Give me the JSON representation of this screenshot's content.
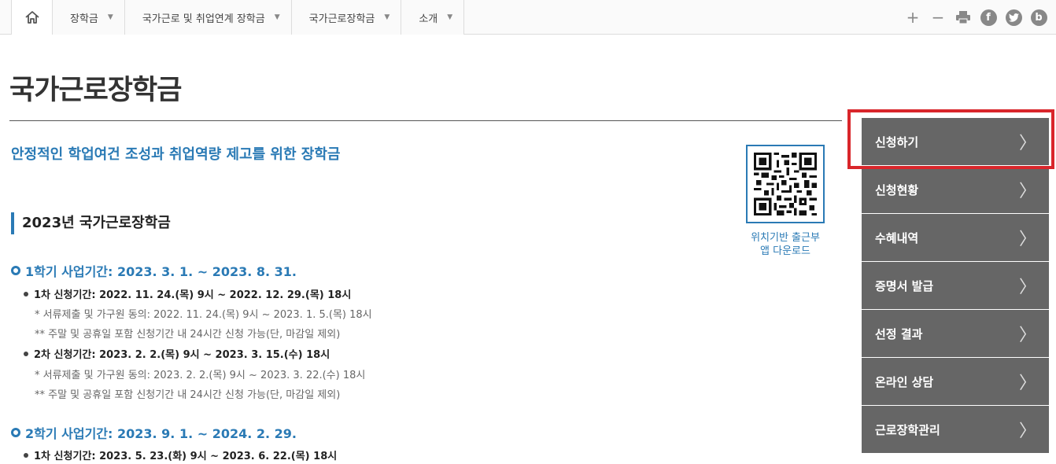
{
  "nav": {
    "items": [
      {
        "label": "장학금"
      },
      {
        "label": "국가근로 및 취업연계 장학금"
      },
      {
        "label": "국가근로장학금"
      },
      {
        "label": "소개"
      }
    ],
    "tools": {
      "plus": "+",
      "minus": "−",
      "facebook": "f",
      "blog": "b"
    }
  },
  "page": {
    "title": "국가근로장학금",
    "subtitle": "안정적인 학업여건 조성과 취업역량 제고를 위한 장학금",
    "qr_caption_line1": "위치기반 출근부",
    "qr_caption_line2": "앱 다운로드",
    "section_title": "2023년 국가근로장학금",
    "period1": "1학기 사업기간: 2023. 3. 1. ~ 2023. 8. 31.",
    "p1_round1": "1차 신청기간: 2022. 11. 24.(목) 9시 ~ 2022. 12. 29.(목) 18시",
    "p1_round1_note1": "* 서류제출 및 가구원 동의: 2022. 11. 24.(목) 9시 ~ 2023. 1. 5.(목) 18시",
    "p1_round1_note2": "** 주말 및 공휴일 포함 신청기간 내 24시간 신청 가능(단, 마감일 제외)",
    "p1_round2": "2차 신청기간: 2023. 2. 2.(목) 9시 ~ 2023. 3. 15.(수) 18시",
    "p1_round2_note1": "* 서류제출 및 가구원 동의: 2023. 2. 2.(목) 9시 ~ 2023. 3. 22.(수) 18시",
    "p1_round2_note2": "** 주말 및 공휴일 포함 신청기간 내 24시간 신청 가능(단, 마감일 제외)",
    "period2": "2학기 사업기간: 2023. 9. 1. ~ 2024. 2. 29.",
    "p2_round1": "1차 신청기간: 2023. 5. 23.(화) 9시 ~ 2023. 6. 22.(목) 18시"
  },
  "side_menu": [
    {
      "label": "신청하기"
    },
    {
      "label": "신청현황"
    },
    {
      "label": "수혜내역"
    },
    {
      "label": "증명서 발급"
    },
    {
      "label": "선정 결과"
    },
    {
      "label": "온라인 상담"
    },
    {
      "label": "근로장학관리"
    }
  ],
  "colors": {
    "accent": "#2a7ab5",
    "side_bg": "#666666",
    "highlight": "#d9262b"
  }
}
